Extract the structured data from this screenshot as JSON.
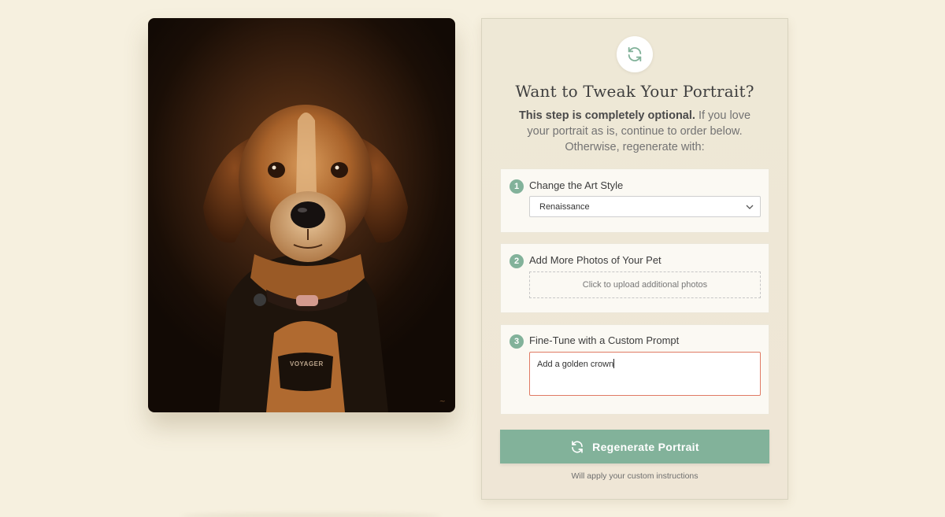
{
  "portrait": {
    "alt": "Oil painting portrait of a beagle mix dog wearing a harness",
    "harness_text": "VOYAGER",
    "icon": "dog-portrait-painting"
  },
  "panel": {
    "icon": "refresh-icon",
    "title": "Want to Tweak Your Portrait?",
    "desc_strong": "This step is completely optional.",
    "desc_rest": " If you love your portrait as is, continue to order below. Otherwise, regenerate with:"
  },
  "steps": [
    {
      "num": "1",
      "title": "Change the Art Style",
      "selected": "Renaissance"
    },
    {
      "num": "2",
      "title": "Add More Photos of Your Pet",
      "upload_label": "Click to upload additional photos"
    },
    {
      "num": "3",
      "title": "Fine-Tune with a Custom Prompt",
      "prompt_value": "Add a golden crown"
    }
  ],
  "button": {
    "label": "Regenerate Portrait",
    "note": "Will apply your custom instructions"
  },
  "colors": {
    "background": "#f6f0df",
    "accent": "#82b29a",
    "prompt_border": "#e07a64"
  }
}
